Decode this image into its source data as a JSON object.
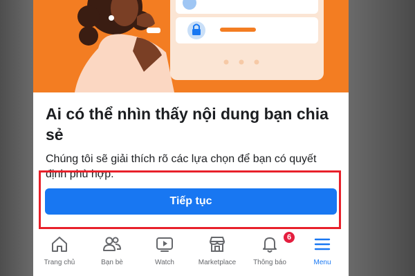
{
  "dialog": {
    "title": "Ai có thể nhìn thấy nội dung bạn chia sẻ",
    "description": "Chúng tôi sẽ giải thích rõ các lựa chọn để bạn có quyết định phù hợp.",
    "continue_label": "Tiếp tục"
  },
  "tabbar": {
    "tabs": [
      {
        "label": "Trang chủ",
        "icon": "home-icon"
      },
      {
        "label": "Bạn bè",
        "icon": "friends-icon"
      },
      {
        "label": "Watch",
        "icon": "watch-icon"
      },
      {
        "label": "Marketplace",
        "icon": "marketplace-icon"
      },
      {
        "label": "Thông báo",
        "icon": "bell-icon",
        "badge": "6"
      },
      {
        "label": "Menu",
        "icon": "menu-icon",
        "active": true
      }
    ]
  },
  "colors": {
    "hero_bg": "#f37d22",
    "primary": "#1877f2",
    "highlight": "#e8202a",
    "badge": "#e41e3f"
  }
}
